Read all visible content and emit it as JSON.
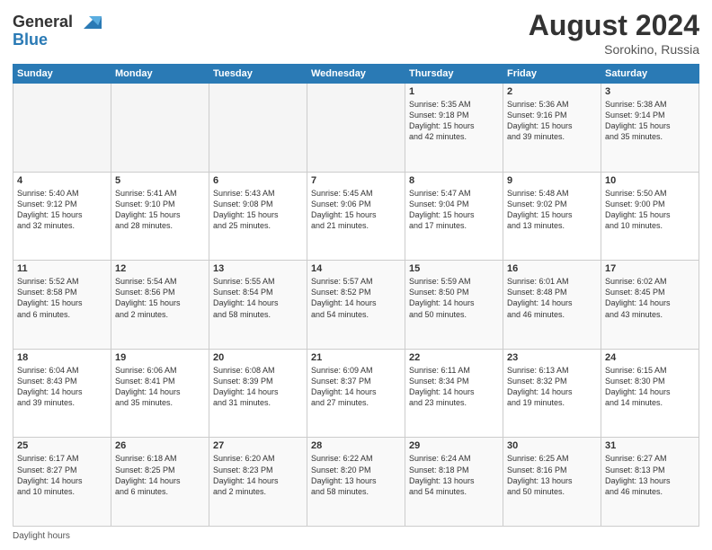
{
  "header": {
    "logo_line1": "General",
    "logo_line2": "Blue",
    "month_year": "August 2024",
    "location": "Sorokino, Russia"
  },
  "weekdays": [
    "Sunday",
    "Monday",
    "Tuesday",
    "Wednesday",
    "Thursday",
    "Friday",
    "Saturday"
  ],
  "weeks": [
    [
      {
        "day": "",
        "info": ""
      },
      {
        "day": "",
        "info": ""
      },
      {
        "day": "",
        "info": ""
      },
      {
        "day": "",
        "info": ""
      },
      {
        "day": "1",
        "info": "Sunrise: 5:35 AM\nSunset: 9:18 PM\nDaylight: 15 hours\nand 42 minutes."
      },
      {
        "day": "2",
        "info": "Sunrise: 5:36 AM\nSunset: 9:16 PM\nDaylight: 15 hours\nand 39 minutes."
      },
      {
        "day": "3",
        "info": "Sunrise: 5:38 AM\nSunset: 9:14 PM\nDaylight: 15 hours\nand 35 minutes."
      }
    ],
    [
      {
        "day": "4",
        "info": "Sunrise: 5:40 AM\nSunset: 9:12 PM\nDaylight: 15 hours\nand 32 minutes."
      },
      {
        "day": "5",
        "info": "Sunrise: 5:41 AM\nSunset: 9:10 PM\nDaylight: 15 hours\nand 28 minutes."
      },
      {
        "day": "6",
        "info": "Sunrise: 5:43 AM\nSunset: 9:08 PM\nDaylight: 15 hours\nand 25 minutes."
      },
      {
        "day": "7",
        "info": "Sunrise: 5:45 AM\nSunset: 9:06 PM\nDaylight: 15 hours\nand 21 minutes."
      },
      {
        "day": "8",
        "info": "Sunrise: 5:47 AM\nSunset: 9:04 PM\nDaylight: 15 hours\nand 17 minutes."
      },
      {
        "day": "9",
        "info": "Sunrise: 5:48 AM\nSunset: 9:02 PM\nDaylight: 15 hours\nand 13 minutes."
      },
      {
        "day": "10",
        "info": "Sunrise: 5:50 AM\nSunset: 9:00 PM\nDaylight: 15 hours\nand 10 minutes."
      }
    ],
    [
      {
        "day": "11",
        "info": "Sunrise: 5:52 AM\nSunset: 8:58 PM\nDaylight: 15 hours\nand 6 minutes."
      },
      {
        "day": "12",
        "info": "Sunrise: 5:54 AM\nSunset: 8:56 PM\nDaylight: 15 hours\nand 2 minutes."
      },
      {
        "day": "13",
        "info": "Sunrise: 5:55 AM\nSunset: 8:54 PM\nDaylight: 14 hours\nand 58 minutes."
      },
      {
        "day": "14",
        "info": "Sunrise: 5:57 AM\nSunset: 8:52 PM\nDaylight: 14 hours\nand 54 minutes."
      },
      {
        "day": "15",
        "info": "Sunrise: 5:59 AM\nSunset: 8:50 PM\nDaylight: 14 hours\nand 50 minutes."
      },
      {
        "day": "16",
        "info": "Sunrise: 6:01 AM\nSunset: 8:48 PM\nDaylight: 14 hours\nand 46 minutes."
      },
      {
        "day": "17",
        "info": "Sunrise: 6:02 AM\nSunset: 8:45 PM\nDaylight: 14 hours\nand 43 minutes."
      }
    ],
    [
      {
        "day": "18",
        "info": "Sunrise: 6:04 AM\nSunset: 8:43 PM\nDaylight: 14 hours\nand 39 minutes."
      },
      {
        "day": "19",
        "info": "Sunrise: 6:06 AM\nSunset: 8:41 PM\nDaylight: 14 hours\nand 35 minutes."
      },
      {
        "day": "20",
        "info": "Sunrise: 6:08 AM\nSunset: 8:39 PM\nDaylight: 14 hours\nand 31 minutes."
      },
      {
        "day": "21",
        "info": "Sunrise: 6:09 AM\nSunset: 8:37 PM\nDaylight: 14 hours\nand 27 minutes."
      },
      {
        "day": "22",
        "info": "Sunrise: 6:11 AM\nSunset: 8:34 PM\nDaylight: 14 hours\nand 23 minutes."
      },
      {
        "day": "23",
        "info": "Sunrise: 6:13 AM\nSunset: 8:32 PM\nDaylight: 14 hours\nand 19 minutes."
      },
      {
        "day": "24",
        "info": "Sunrise: 6:15 AM\nSunset: 8:30 PM\nDaylight: 14 hours\nand 14 minutes."
      }
    ],
    [
      {
        "day": "25",
        "info": "Sunrise: 6:17 AM\nSunset: 8:27 PM\nDaylight: 14 hours\nand 10 minutes."
      },
      {
        "day": "26",
        "info": "Sunrise: 6:18 AM\nSunset: 8:25 PM\nDaylight: 14 hours\nand 6 minutes."
      },
      {
        "day": "27",
        "info": "Sunrise: 6:20 AM\nSunset: 8:23 PM\nDaylight: 14 hours\nand 2 minutes."
      },
      {
        "day": "28",
        "info": "Sunrise: 6:22 AM\nSunset: 8:20 PM\nDaylight: 13 hours\nand 58 minutes."
      },
      {
        "day": "29",
        "info": "Sunrise: 6:24 AM\nSunset: 8:18 PM\nDaylight: 13 hours\nand 54 minutes."
      },
      {
        "day": "30",
        "info": "Sunrise: 6:25 AM\nSunset: 8:16 PM\nDaylight: 13 hours\nand 50 minutes."
      },
      {
        "day": "31",
        "info": "Sunrise: 6:27 AM\nSunset: 8:13 PM\nDaylight: 13 hours\nand 46 minutes."
      }
    ]
  ],
  "footer": {
    "daylight_hours": "Daylight hours"
  }
}
